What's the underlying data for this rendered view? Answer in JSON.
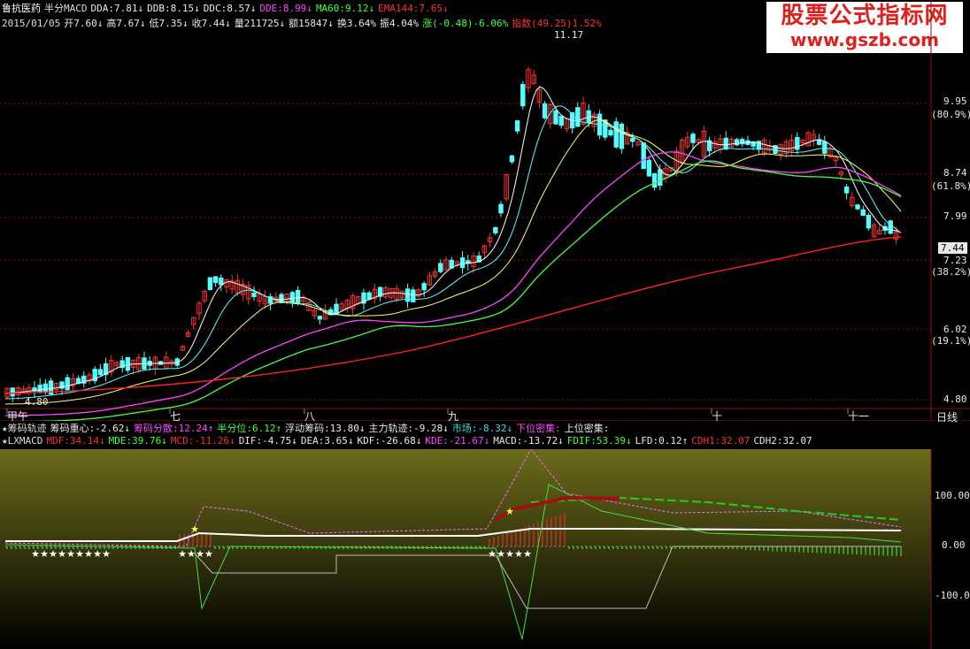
{
  "header": {
    "stock_name": "鲁抗医药",
    "period_label": "半分MACD",
    "indicators": [
      {
        "text": "DDA:7.81↓",
        "color": "#e8e8e8"
      },
      {
        "text": "DDB:8.15↓",
        "color": "#e8e8e8"
      },
      {
        "text": "DDC:8.57↓",
        "color": "#e8e8e8"
      },
      {
        "text": "DDE:8.99↓",
        "color": "#ff44ff"
      },
      {
        "text": "MA60:9.12↓",
        "color": "#44ff44"
      },
      {
        "text": "EMA144:7.65↓",
        "color": "#ff3030"
      }
    ]
  },
  "quote_line": {
    "date": "2015/01/05",
    "open": "开7.60↓",
    "high": "高7.67↓",
    "low": "低7.35↓",
    "close": "收7.44↓",
    "volume": "量211725↓",
    "amount": "额15847↓",
    "turnover": "换3.64%",
    "amplitude": "振4.04%",
    "change": "涨(-0.48)-6.06%",
    "index": "指数(49.25)1.52%"
  },
  "watermark": {
    "line1": "股票公式指标网",
    "line2": "www.gszb.com"
  },
  "price_axis": {
    "ticks": [
      "9.95",
      "(80.9%)",
      "8.74",
      "(61.8%)",
      "7.99",
      "7.23",
      "(38.2%)",
      "6.02",
      "(19.1%)",
      "4.80"
    ],
    "current_price": "7.44",
    "max_label": "11.17",
    "min_label": "4.80"
  },
  "months": [
    "甲午",
    "七",
    "八",
    "九",
    "十",
    "十一"
  ],
  "period_button": "日线",
  "indicator1": {
    "name": "★筹码轨迹",
    "items": [
      {
        "text": "筹码重心:-2.62↓",
        "color": "#e8e8e8"
      },
      {
        "text": "筹码分散:12.24↑",
        "color": "#ff44ff"
      },
      {
        "text": "半分位:6.12↑",
        "color": "#44ff44"
      },
      {
        "text": "浮动筹码:13.80↓",
        "color": "#e8e8e8"
      },
      {
        "text": "主力轨迹:-9.28↓",
        "color": "#e8e8e8"
      },
      {
        "text": "市场:-8.32↓",
        "color": "#44dddd"
      },
      {
        "text": "下位密集:",
        "color": "#ff44ff"
      },
      {
        "text": "上位密集:",
        "color": "#e8e8e8"
      }
    ]
  },
  "indicator2": {
    "name": "★LXMACD",
    "items": [
      {
        "text": "MDF:34.14↓",
        "color": "#ff3030"
      },
      {
        "text": "MDE:39.76↓",
        "color": "#44ff44"
      },
      {
        "text": "MCD:-11.26↓",
        "color": "#ff3030"
      },
      {
        "text": "DIF:-4.75↓",
        "color": "#e8e8e8"
      },
      {
        "text": "DEA:3.65↓",
        "color": "#e8e8e8"
      },
      {
        "text": "KDF:-26.68↓",
        "color": "#e8e8e8"
      },
      {
        "text": "KDE:-21.67↓",
        "color": "#ff44ff"
      },
      {
        "text": "MACD:-13.72↓",
        "color": "#e8e8e8"
      },
      {
        "text": "FDIF:53.39↓",
        "color": "#44ff44"
      },
      {
        "text": "LFD:0.12↑",
        "color": "#e8e8e8"
      },
      {
        "text": "CDH1:32.07",
        "color": "#ff3030"
      },
      {
        "text": "CDH2:32.07",
        "color": "#e8e8e8"
      }
    ]
  },
  "sub_axis": {
    "ticks": [
      "100.00",
      "0.00",
      "-100.0"
    ]
  },
  "colors": {
    "up": "#ff3030",
    "down": "#54ffff",
    "grid": "#8a1010",
    "sub_bg_top": "#6b6b1a",
    "sub_bg_bottom": "#000000"
  }
}
